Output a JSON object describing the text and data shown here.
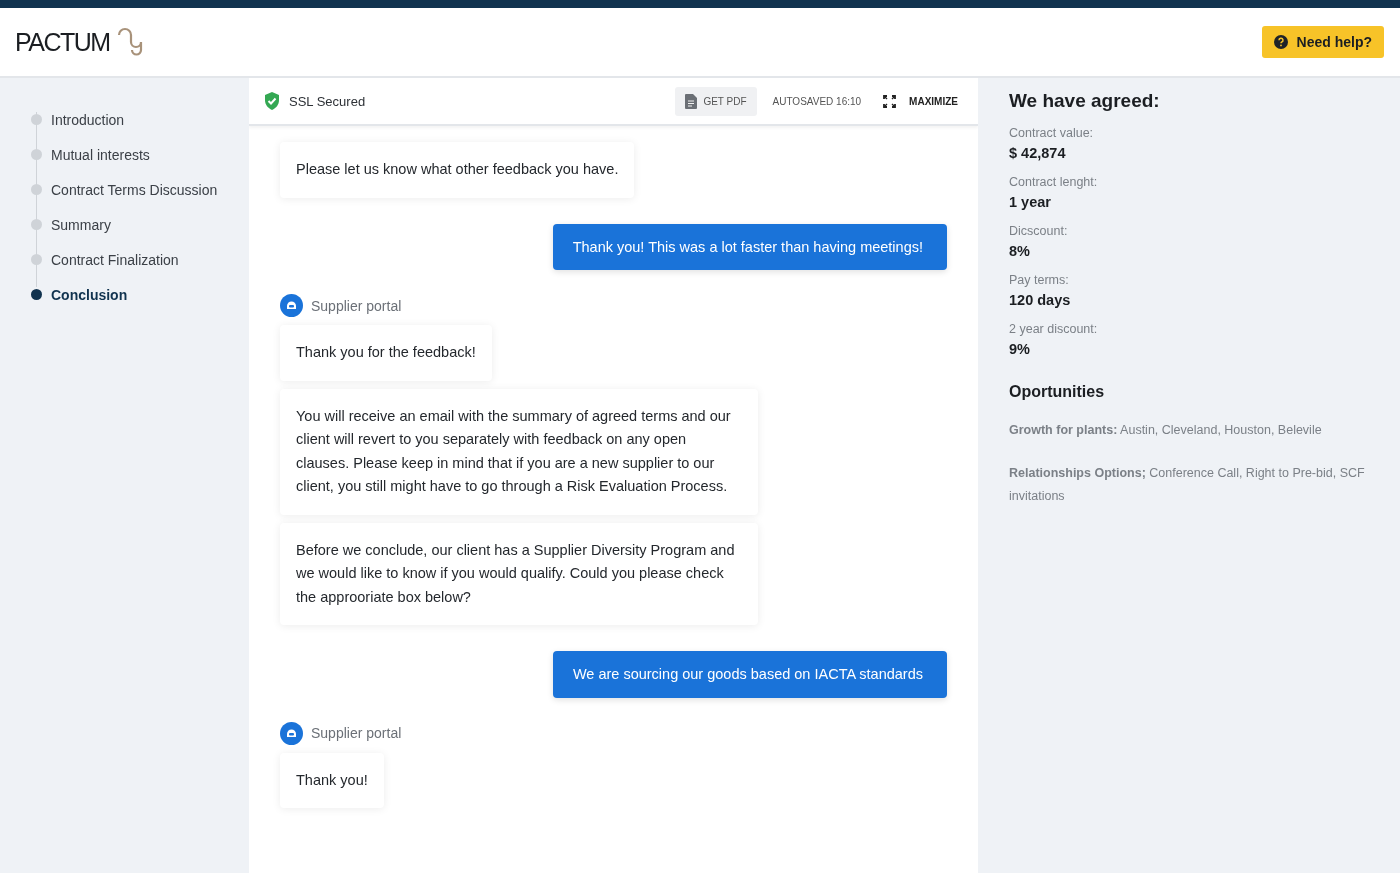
{
  "brand": {
    "name": "PACTUM"
  },
  "help_button": {
    "label": "Need help?"
  },
  "steps": [
    {
      "label": "Introduction",
      "selected": false
    },
    {
      "label": "Mutual interests",
      "selected": false
    },
    {
      "label": "Contract Terms Discussion",
      "selected": false
    },
    {
      "label": "Summary",
      "selected": false
    },
    {
      "label": "Contract Finalization",
      "selected": false
    },
    {
      "label": "Conclusion",
      "selected": true
    }
  ],
  "toolbar": {
    "security": "SSL Secured",
    "pdf_button": "GET PDF",
    "autosave": "AUTOSAVED 16:10",
    "maximize_button": "MAXIMIZE"
  },
  "messages": [
    {
      "kind": "incoming",
      "text": "Please let us know what other feedback you have."
    },
    {
      "kind": "outgoing",
      "text": "Thank you! This was a lot faster than having meetings!"
    },
    {
      "kind": "sender",
      "text": "Supplier portal"
    },
    {
      "kind": "incoming",
      "text": "Thank you for the feedback!"
    },
    {
      "kind": "incoming",
      "text": "You will receive an email with the summary of agreed terms and our client will revert to you separately with feedback on any open clauses. Please keep in mind that if you are a new supplier to our client, you still might have to go through a Risk Evaluation Process."
    },
    {
      "kind": "incoming",
      "text": "Before we conclude, our client has a Supplier Diversity Program and we would like to know if you would qualify. Could you please check the approoriate box below?"
    },
    {
      "kind": "outgoing",
      "text": "We are sourcing our goods based on IACTA standards"
    },
    {
      "kind": "sender",
      "text": "Supplier portal"
    },
    {
      "kind": "incoming",
      "text": "Thank you!"
    }
  ],
  "summary": {
    "title": "We have agreed:",
    "terms": [
      {
        "label": "Contract value:",
        "value": "$ 42,874"
      },
      {
        "label": "Contract lenght:",
        "value": "1 year"
      },
      {
        "label": "Dicscount:",
        "value": "8%"
      },
      {
        "label": "Pay terms:",
        "value": "120 days"
      },
      {
        "label": "2 year discount:",
        "value": "9%"
      }
    ],
    "opportunities_title": "Oportunities",
    "opportunities": [
      "**Growth for plants:** Austin, Cleveland, Houston, Belevile",
      "**Relationships Options;** Conference Call, Right to Pre-bid, SCF invitations"
    ]
  }
}
